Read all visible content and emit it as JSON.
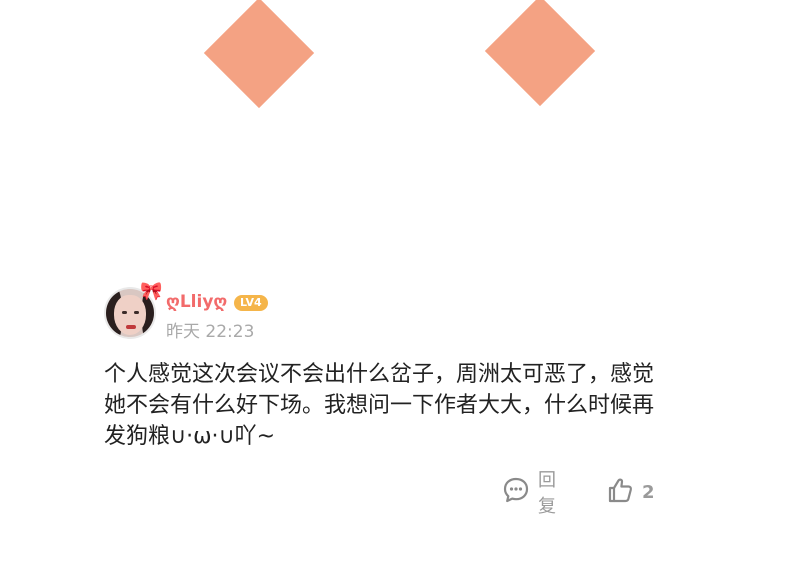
{
  "header": {
    "decoration_color": "#f4a283"
  },
  "comment": {
    "username": "ღLliyღ",
    "level_badge": "LV4",
    "timestamp": "昨天 22:23",
    "text": "个人感觉这次会议不会出什么岔子，周洲太可恶了，感觉她不会有什么好下场。我想问一下作者大大，什么时候再发狗粮∪·ω·∪吖~",
    "avatar_icon": "avatar-photo",
    "actions": {
      "reply_icon": "chat-bubble-icon",
      "reply_label": "回复",
      "like_icon": "thumbs-up-icon",
      "like_count": "2"
    }
  },
  "colors": {
    "username": "#f26b6b",
    "badge": "#f5b54a",
    "meta": "#a9a9a9"
  }
}
